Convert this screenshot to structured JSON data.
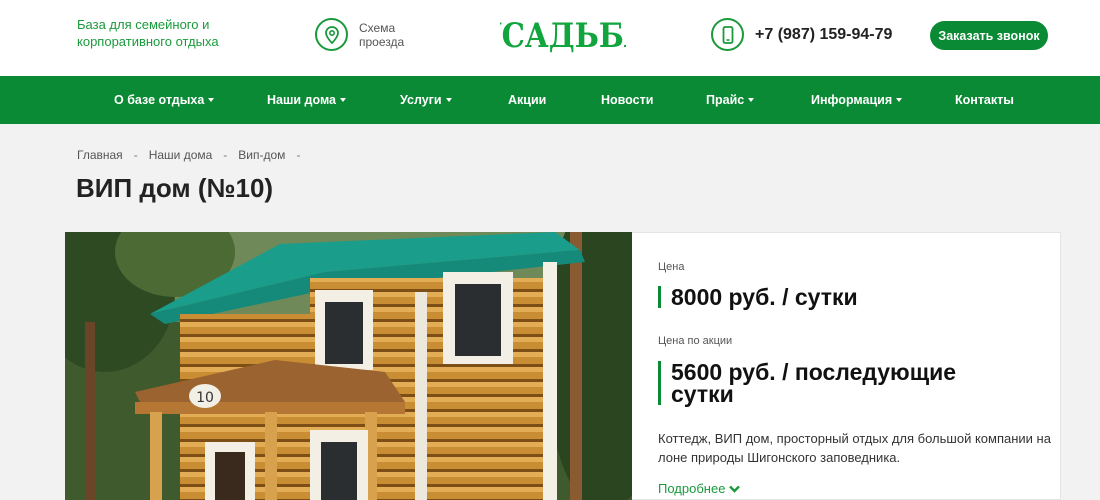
{
  "header": {
    "tagline": "База для семейного и корпоративного отдыха",
    "route_label": "Схема проезда",
    "logo_text": "УСАДЬБА",
    "phone": "+7 (987) 159-94-79",
    "callback_label": "Заказать звонок",
    "brand_color": "#0b8a35"
  },
  "nav": {
    "items": [
      {
        "label": "О базе отдыха"
      },
      {
        "label": "Наши дома"
      },
      {
        "label": "Услуги"
      },
      {
        "label": "Акции"
      },
      {
        "label": "Новости"
      },
      {
        "label": "Прайс"
      },
      {
        "label": "Информация"
      },
      {
        "label": "Контакты"
      }
    ]
  },
  "breadcrumb": {
    "items": [
      "Главная",
      "Наши дома",
      "Вип-дом"
    ],
    "separator": "-"
  },
  "page": {
    "title": "ВИП дом (№10)"
  },
  "card": {
    "price_label": "Цена",
    "price": "8000 руб. / сутки",
    "promo_label": "Цена по акции",
    "promo_price": "5600 руб. / последующие сутки",
    "description": "Коттедж, ВИП дом, просторный отдых для большой компании на лоне природы Шигонского заповедника.",
    "more_label": "Подробнее"
  },
  "photo": {
    "house_number": "10"
  }
}
